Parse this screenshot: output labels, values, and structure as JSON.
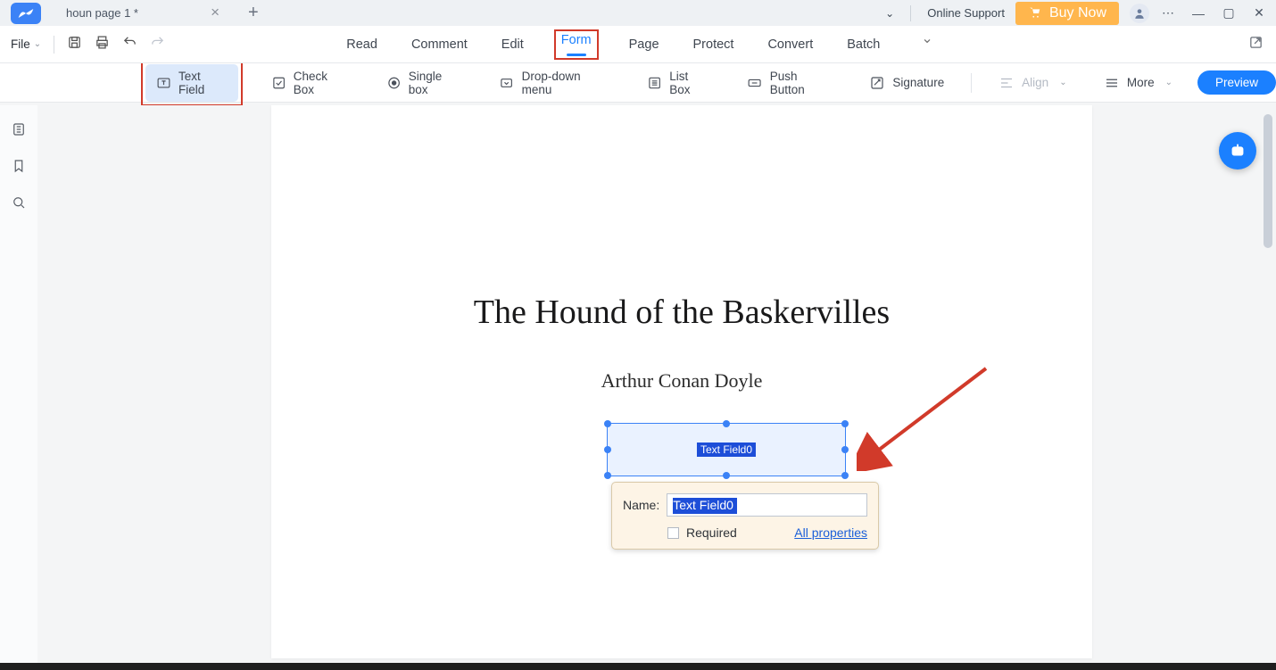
{
  "titlebar": {
    "tab_title": "houn page 1 *",
    "online_support": "Online Support",
    "buy_now": "Buy Now"
  },
  "menu": {
    "file": "File",
    "tabs": [
      "Read",
      "Comment",
      "Edit",
      "Form",
      "Page",
      "Protect",
      "Convert",
      "Batch"
    ],
    "active_index": 3
  },
  "toolbar": {
    "text_field": "Text Field",
    "check_box": "Check Box",
    "single_box": "Single box",
    "drop_down": "Drop-down menu",
    "list_box": "List Box",
    "push_button": "Push Button",
    "signature": "Signature",
    "align": "Align",
    "more": "More",
    "preview": "Preview"
  },
  "document": {
    "title": "The Hound of the Baskervilles",
    "author": "Arthur Conan Doyle",
    "field_placeholder_label": "Text Field0"
  },
  "props": {
    "name_label": "Name:",
    "name_value": "Text Field0",
    "required_label": "Required",
    "all_properties": "All properties"
  }
}
